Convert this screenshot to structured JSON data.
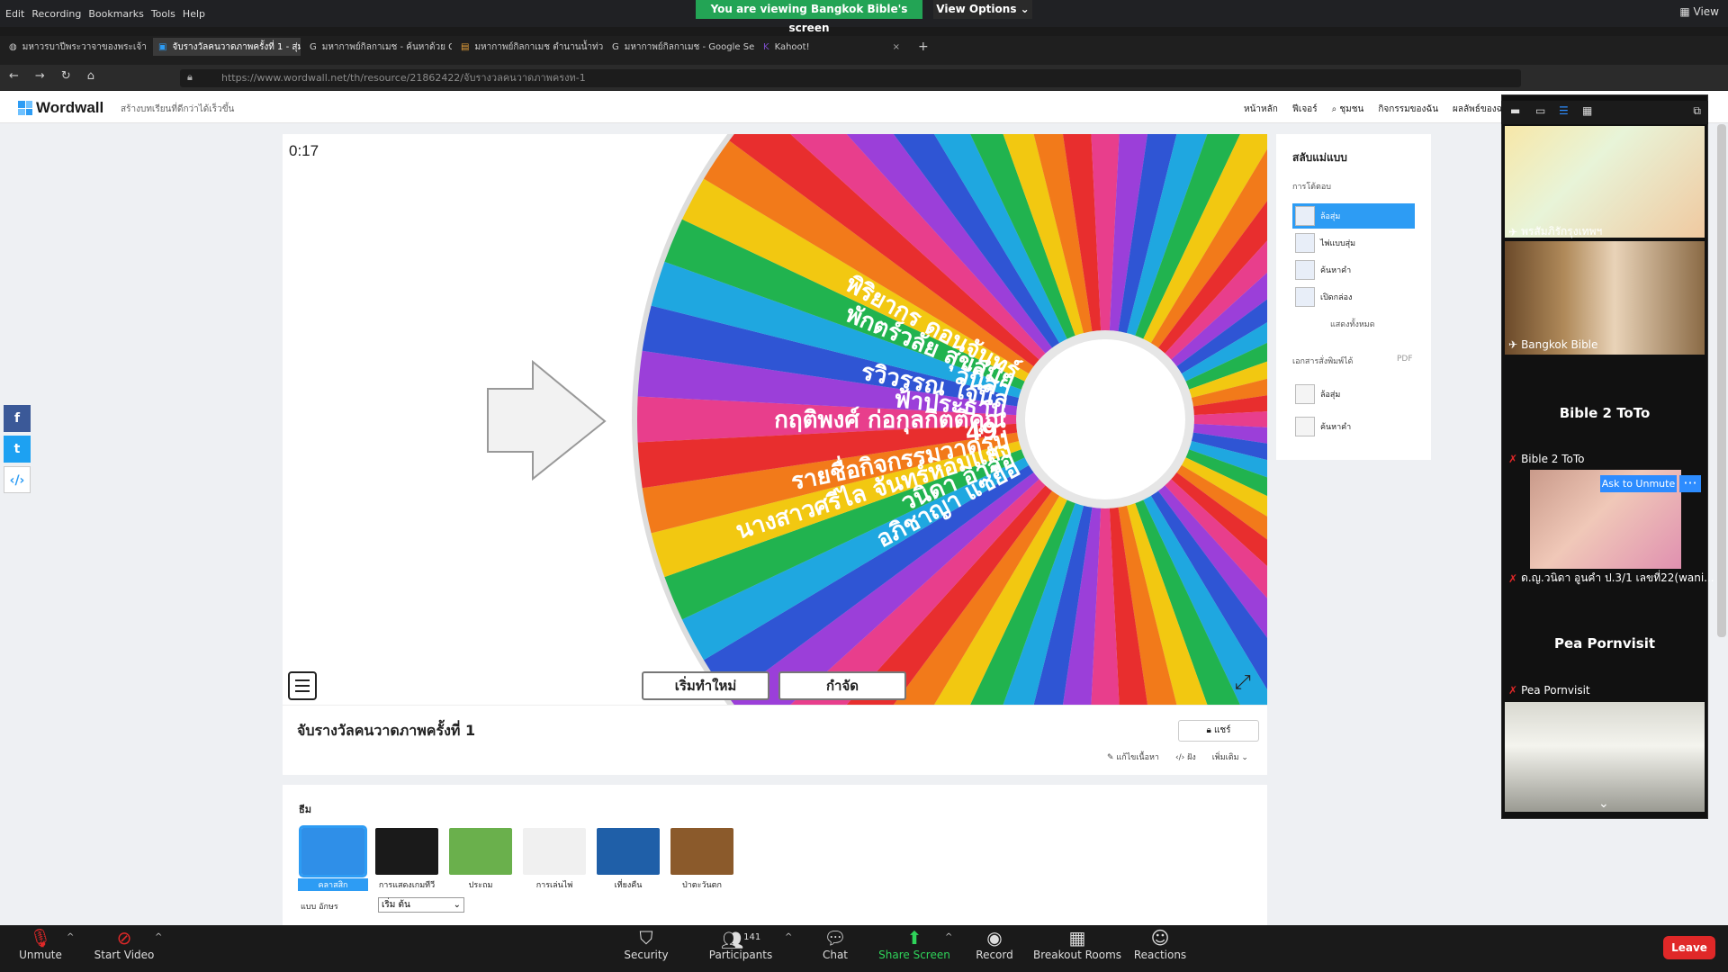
{
  "zoom": {
    "menu_items": [
      "Edit",
      "Recording",
      "Bookmarks",
      "Tools",
      "Help"
    ],
    "viewing_banner": "You are viewing Bangkok Bible's screen",
    "view_options": "View Options ⌄",
    "view_button": "View"
  },
  "browser": {
    "tabs": [
      {
        "label": "มหาวรบาปีพระวาจาของพระเจ้า",
        "active": false
      },
      {
        "label": "จับรางวัลคนวาดภาพครั้งที่ 1 - สุ่มว",
        "active": true
      },
      {
        "label": "มหากาพย์กิลกาเมช - ค้นหาด้วย G",
        "active": false
      },
      {
        "label": "มหากาพย์กิลกาเมช ตำนานน้ำท่วม",
        "active": false
      },
      {
        "label": "มหากาพย์กิลกาเมช - Google Sea",
        "active": false
      },
      {
        "label": "Kahoot!",
        "active": false
      }
    ],
    "url": "https://www.wordwall.net/th/resource/21862422/จับรางวลคนวาดภาพครงท-1"
  },
  "wordwall": {
    "logo": "Wordwall",
    "tagline": "สร้างบทเรียนที่ดีกว่าได้เร็วขึ้น",
    "nav": [
      "หน้าหลัก",
      "ฟีเจอร์",
      "ชุมชน",
      "กิจกรรมของฉัน",
      "ผลลัพธ์ของฉ"
    ],
    "timer": "0:17",
    "wheel_labels": [
      "อภิชาญา แซ่ยือ",
      "วนิดา อาจอ",
      "นางสาวศรีไล จันทร์หอมแสง",
      "รายชื่อกิจกรรมวาดรูป",
      "49.",
      "กฤติพงศ์ ก่อกุลกิตติคุณ",
      "ฟ้าประธาน",
      "รวิวรรณ ใจนิล",
      "วันิสา",
      "พักตร์วลัย สุขสมัย",
      "พิริยากร ดอนจันทร์"
    ],
    "restart_button": "เริ่มทำใหม่",
    "eliminate_button": "กำจัด",
    "game_title": "จับรางวัลคนวาดภาพครั้งที่ 1",
    "share_button": "แชร์",
    "edit_links": [
      "แก้ไขเนื้อหา",
      "ฝัง",
      "เพิ่มเติม"
    ],
    "themes_heading": "ธีม",
    "themes": [
      {
        "label": "คลาสสิก",
        "color": "#2f8fe8"
      },
      {
        "label": "การแสดงเกมทีวี",
        "color": "#1a1a1a"
      },
      {
        "label": "ประถม",
        "color": "#6ab04c"
      },
      {
        "label": "การเล่นไพ่",
        "color": "#f0f0f0"
      },
      {
        "label": "เที่ยงคืน",
        "color": "#1f5fa8"
      },
      {
        "label": "ป่าตะวันตก",
        "color": "#8b5a2b"
      }
    ],
    "font_label": "แบบ อักษร",
    "font_value": "เริ่ม ต้น",
    "template_panel": {
      "title": "สลับแม่แบบ",
      "interactive_label": "การโต้ตอบ",
      "options": [
        "ล้อสุ่ม",
        "ไพ่แบบสุ่ม",
        "ค้นหาคำ",
        "เปิดกล่อง"
      ],
      "show_all": "แสดงทั้งหมด",
      "printables_label": "เอกสารสั่งพิมพ์ได้",
      "pdf": "PDF",
      "printables": [
        "ล้อสุ่ม",
        "ค้นหาคำ"
      ]
    }
  },
  "gallery": {
    "tiles": [
      {
        "label": "พรสัมภิรักรุงเทพฯ"
      },
      {
        "label": "Bangkok Bible"
      },
      {
        "name": "Bible 2 ToTo",
        "label": "Bible 2 ToTo"
      },
      {
        "label": "ด.ญ.วนิดา อูนคำ ป.3/1 เลขที่22(wani..."
      },
      {
        "name": "Pea Pornvisit",
        "label": "Pea Pornvisit"
      }
    ],
    "ask_to_unmute": "Ask to Unmute",
    "more": "···"
  },
  "toolbar": {
    "unmute": "Unmute",
    "start_video": "Start Video",
    "security": "Security",
    "participants": "Participants",
    "participant_count": "141",
    "chat": "Chat",
    "share_screen": "Share Screen",
    "record": "Record",
    "breakout_rooms": "Breakout Rooms",
    "reactions": "Reactions",
    "leave": "Leave"
  },
  "colors": {
    "share_green": "#23a455",
    "zoom_blue": "#2d8cff",
    "leave_red": "#e02828",
    "selected_blue": "#2d9cf4"
  }
}
